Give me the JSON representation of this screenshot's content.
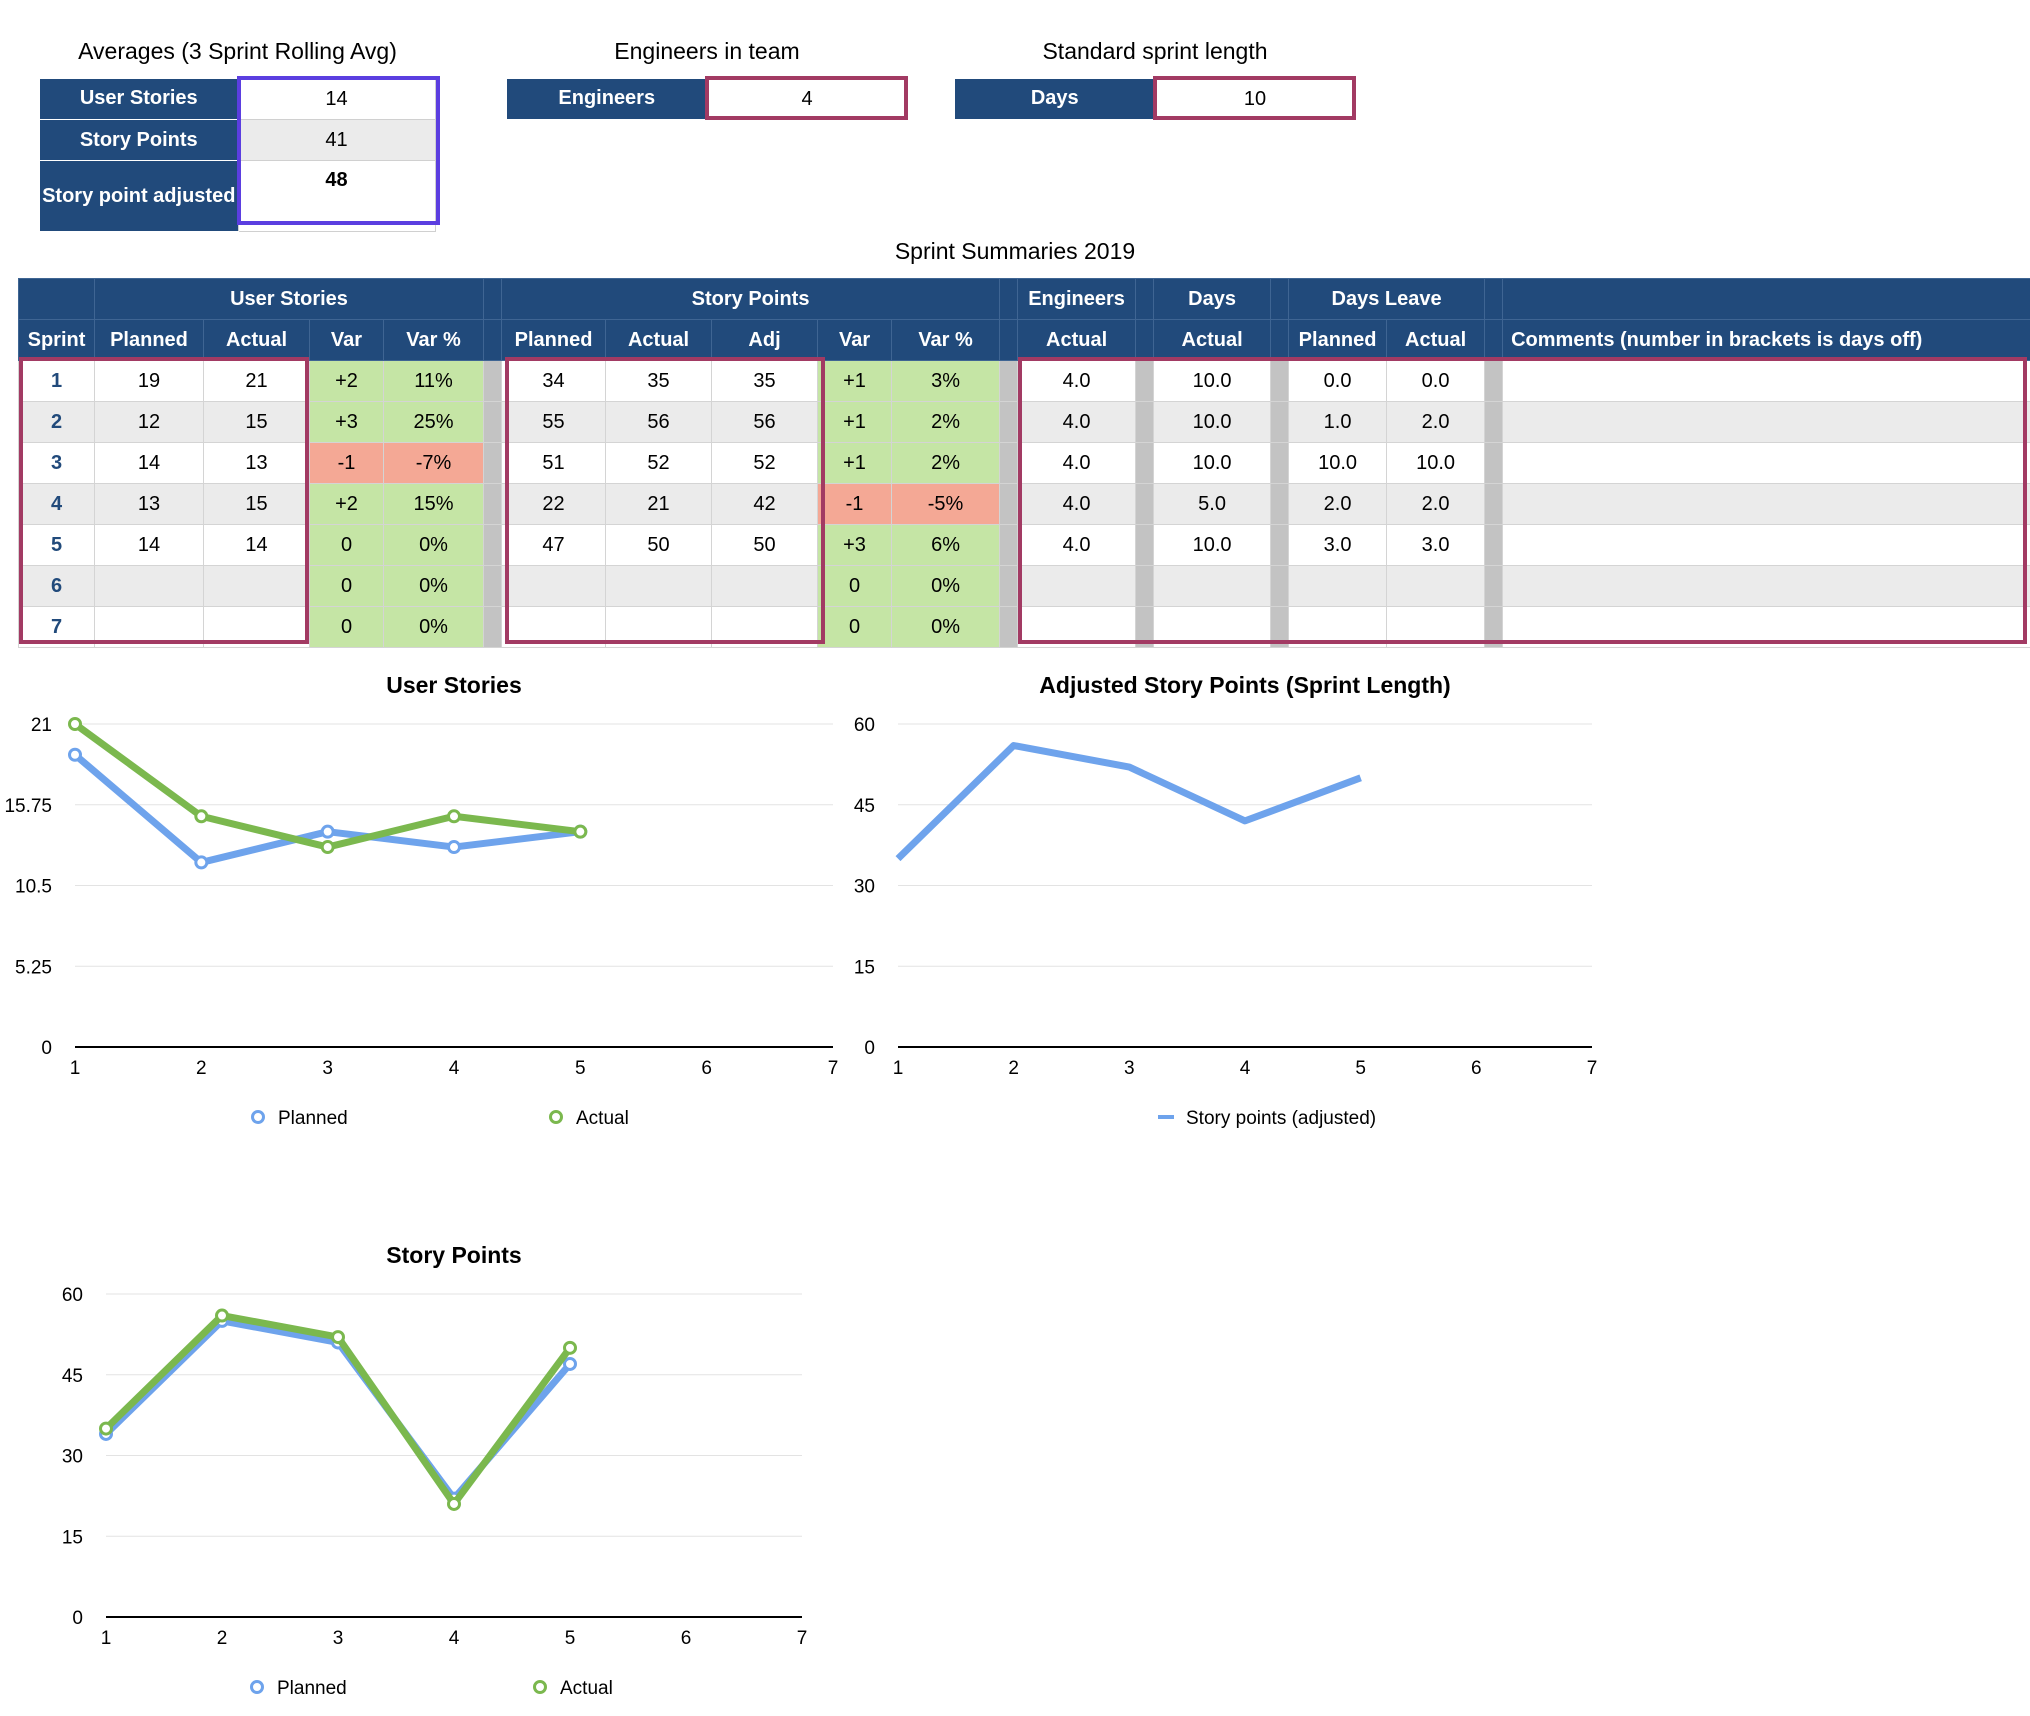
{
  "averages": {
    "title": "Averages (3 Sprint Rolling Avg)",
    "rows": [
      {
        "label": "User Stories",
        "value": "14"
      },
      {
        "label": "Story Points",
        "value": "41"
      },
      {
        "label": "Story point adjusted",
        "value": "48"
      }
    ]
  },
  "engineers": {
    "title": "Engineers in team",
    "label": "Engineers",
    "value": "4"
  },
  "sprint_length": {
    "title": "Standard sprint length",
    "label": "Days",
    "value": "10"
  },
  "summary": {
    "title": "Sprint Summaries 2019",
    "group_headers": [
      "User Stories",
      "Story Points",
      "Engineers",
      "Days",
      "Days Leave"
    ],
    "col_headers": [
      "Sprint",
      "Planned",
      "Actual",
      "Var",
      "Var %",
      "Planned",
      "Actual",
      "Adj",
      "Var",
      "Var %",
      "Actual",
      "Actual",
      "Planned",
      "Actual",
      "Comments (number in brackets is days off)"
    ],
    "rows": [
      [
        "1",
        "19",
        "21",
        "+2",
        "11%",
        "34",
        "35",
        "35",
        "+1",
        "3%",
        "4.0",
        "10.0",
        "0.0",
        "0.0",
        ""
      ],
      [
        "2",
        "12",
        "15",
        "+3",
        "25%",
        "55",
        "56",
        "56",
        "+1",
        "2%",
        "4.0",
        "10.0",
        "1.0",
        "2.0",
        ""
      ],
      [
        "3",
        "14",
        "13",
        "-1",
        "-7%",
        "51",
        "52",
        "52",
        "+1",
        "2%",
        "4.0",
        "10.0",
        "10.0",
        "10.0",
        ""
      ],
      [
        "4",
        "13",
        "15",
        "+2",
        "15%",
        "22",
        "21",
        "42",
        "-1",
        "-5%",
        "4.0",
        "5.0",
        "2.0",
        "2.0",
        ""
      ],
      [
        "5",
        "14",
        "14",
        "0",
        "0%",
        "47",
        "50",
        "50",
        "+3",
        "6%",
        "4.0",
        "10.0",
        "3.0",
        "3.0",
        ""
      ],
      [
        "6",
        "",
        "",
        "0",
        "0%",
        "",
        "",
        "",
        "0",
        "0%",
        "",
        "",
        "",
        "",
        ""
      ],
      [
        "7",
        "",
        "",
        "0",
        "0%",
        "",
        "",
        "",
        "0",
        "0%",
        "",
        "",
        "",
        "",
        ""
      ]
    ],
    "colors": {
      "header": "#214a7b",
      "positive": "#c5e5a5",
      "negative": "#f4a895",
      "highlight_frame": "#a23a63",
      "averages_frame": "#5b3ee0"
    }
  },
  "chart_data": [
    {
      "id": "us",
      "type": "line",
      "title": "User Stories",
      "x": [
        1,
        2,
        3,
        4,
        5,
        6,
        7
      ],
      "xlim": [
        1,
        7
      ],
      "ylim": [
        0,
        21
      ],
      "yticks": [
        "0",
        "5.25",
        "10.5",
        "15.75",
        "21"
      ],
      "markers": true,
      "series": [
        {
          "name": "Planned",
          "values": [
            19,
            12,
            14,
            13,
            14
          ],
          "color": "#6ea3ec"
        },
        {
          "name": "Actual",
          "values": [
            21,
            15,
            13,
            15,
            14
          ],
          "color": "#7bb84e"
        }
      ],
      "legend": "bottom"
    },
    {
      "id": "asp",
      "type": "line",
      "title": "Adjusted Story Points (Sprint Length)",
      "x": [
        1,
        2,
        3,
        4,
        5,
        6,
        7
      ],
      "xlim": [
        1,
        7
      ],
      "ylim": [
        0,
        60
      ],
      "yticks": [
        "0",
        "15",
        "30",
        "45",
        "60"
      ],
      "markers": false,
      "series": [
        {
          "name": "Story points (adjusted)",
          "values": [
            35,
            56,
            52,
            42,
            50
          ],
          "color": "#6ea3ec"
        }
      ],
      "legend": "bottom"
    },
    {
      "id": "sp",
      "type": "line",
      "title": "Story Points",
      "x": [
        1,
        2,
        3,
        4,
        5,
        6,
        7
      ],
      "xlim": [
        1,
        7
      ],
      "ylim": [
        0,
        60
      ],
      "yticks": [
        "0",
        "15",
        "30",
        "45",
        "60"
      ],
      "markers": true,
      "series": [
        {
          "name": "Planned",
          "values": [
            34,
            55,
            51,
            22,
            47
          ],
          "color": "#6ea3ec"
        },
        {
          "name": "Actual",
          "values": [
            35,
            56,
            52,
            21,
            50
          ],
          "color": "#7bb84e"
        }
      ],
      "legend": "bottom"
    }
  ]
}
